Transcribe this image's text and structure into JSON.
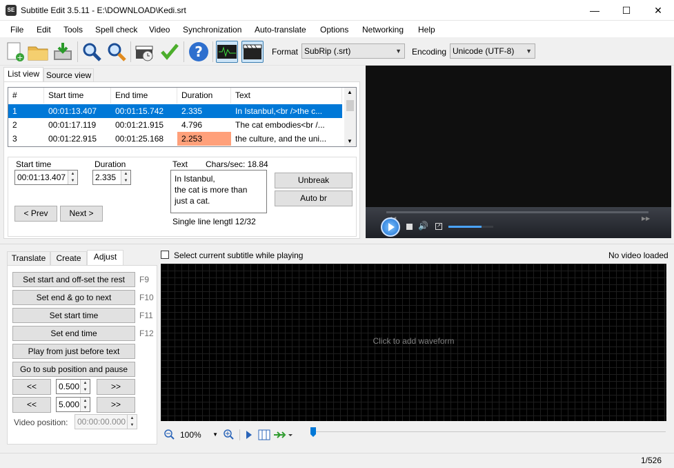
{
  "window": {
    "title": "Subtitle Edit 3.5.11 - E:\\DOWNLOAD\\Kedi.srt",
    "minimize": "—",
    "maximize": "☐",
    "close": "✕"
  },
  "menu": [
    "File",
    "Edit",
    "Tools",
    "Spell check",
    "Video",
    "Synchronization",
    "Auto-translate",
    "Options",
    "Networking",
    "Help"
  ],
  "toolbar": {
    "format_label": "Format",
    "format_value": "SubRip (.srt)",
    "encoding_label": "Encoding",
    "encoding_value": "Unicode (UTF-8)",
    "icons": [
      "new-file-icon",
      "open-folder-icon",
      "save-icon",
      "find-icon",
      "replace-icon",
      "visual-sync-icon",
      "spell-check-icon",
      "help-icon",
      "waveform-toggle-icon",
      "video-toggle-icon"
    ]
  },
  "top_tabs": [
    "List view",
    "Source view"
  ],
  "grid": {
    "headers": [
      "#",
      "Start time",
      "End time",
      "Duration",
      "Text"
    ],
    "rows": [
      {
        "num": "1",
        "start": "00:01:13.407",
        "end": "00:01:15.742",
        "duration": "2.335",
        "text": "In Istanbul,<br />the c..."
      },
      {
        "num": "2",
        "start": "00:01:17.119",
        "end": "00:01:21.915",
        "duration": "4.796",
        "text": "The cat embodies<br /..."
      },
      {
        "num": "3",
        "start": "00:01:22.915",
        "end": "00:01:25.168",
        "duration": "2.253",
        "text": "the culture, and the uni..."
      }
    ]
  },
  "edit": {
    "start_time_label": "Start time",
    "start_time_value": "00:01:13.407",
    "duration_label": "Duration",
    "duration_value": "2.335",
    "text_label": "Text",
    "chars_per_sec": "Chars/sec: 18.84",
    "text_lines": [
      "In Istanbul,",
      "the cat is more than",
      "just a cat."
    ],
    "single_line_length": "Single line lengtl 12/32",
    "unbreak": "Unbreak",
    "auto_br": "Auto br",
    "prev": "< Prev",
    "next": "Next >"
  },
  "bottom_tabs": [
    "Translate",
    "Create",
    "Adjust"
  ],
  "adjust": {
    "buttons": [
      {
        "label": "Set start and off-set the rest",
        "key": "F9"
      },
      {
        "label": "Set end & go to next",
        "key": "F10"
      },
      {
        "label": "Set start time",
        "key": "F11"
      },
      {
        "label": "Set end time",
        "key": "F12"
      },
      {
        "label": "Play from just before text",
        "key": ""
      },
      {
        "label": "Go to sub position and pause",
        "key": ""
      }
    ],
    "back_label": "<<",
    "fwd_label": ">>",
    "step1": "0.500",
    "step2": "5.000",
    "video_position_label": "Video position:",
    "video_position_value": "00:00:00.000"
  },
  "waveform": {
    "select_current_label": "Select current subtitle while playing",
    "no_video": "No video loaded",
    "hint": "Click to add waveform",
    "zoom": "100%"
  },
  "status": {
    "position": "1/526"
  },
  "colors": {
    "selection": "#0078d7",
    "duration_warning": "#ffa07a"
  }
}
